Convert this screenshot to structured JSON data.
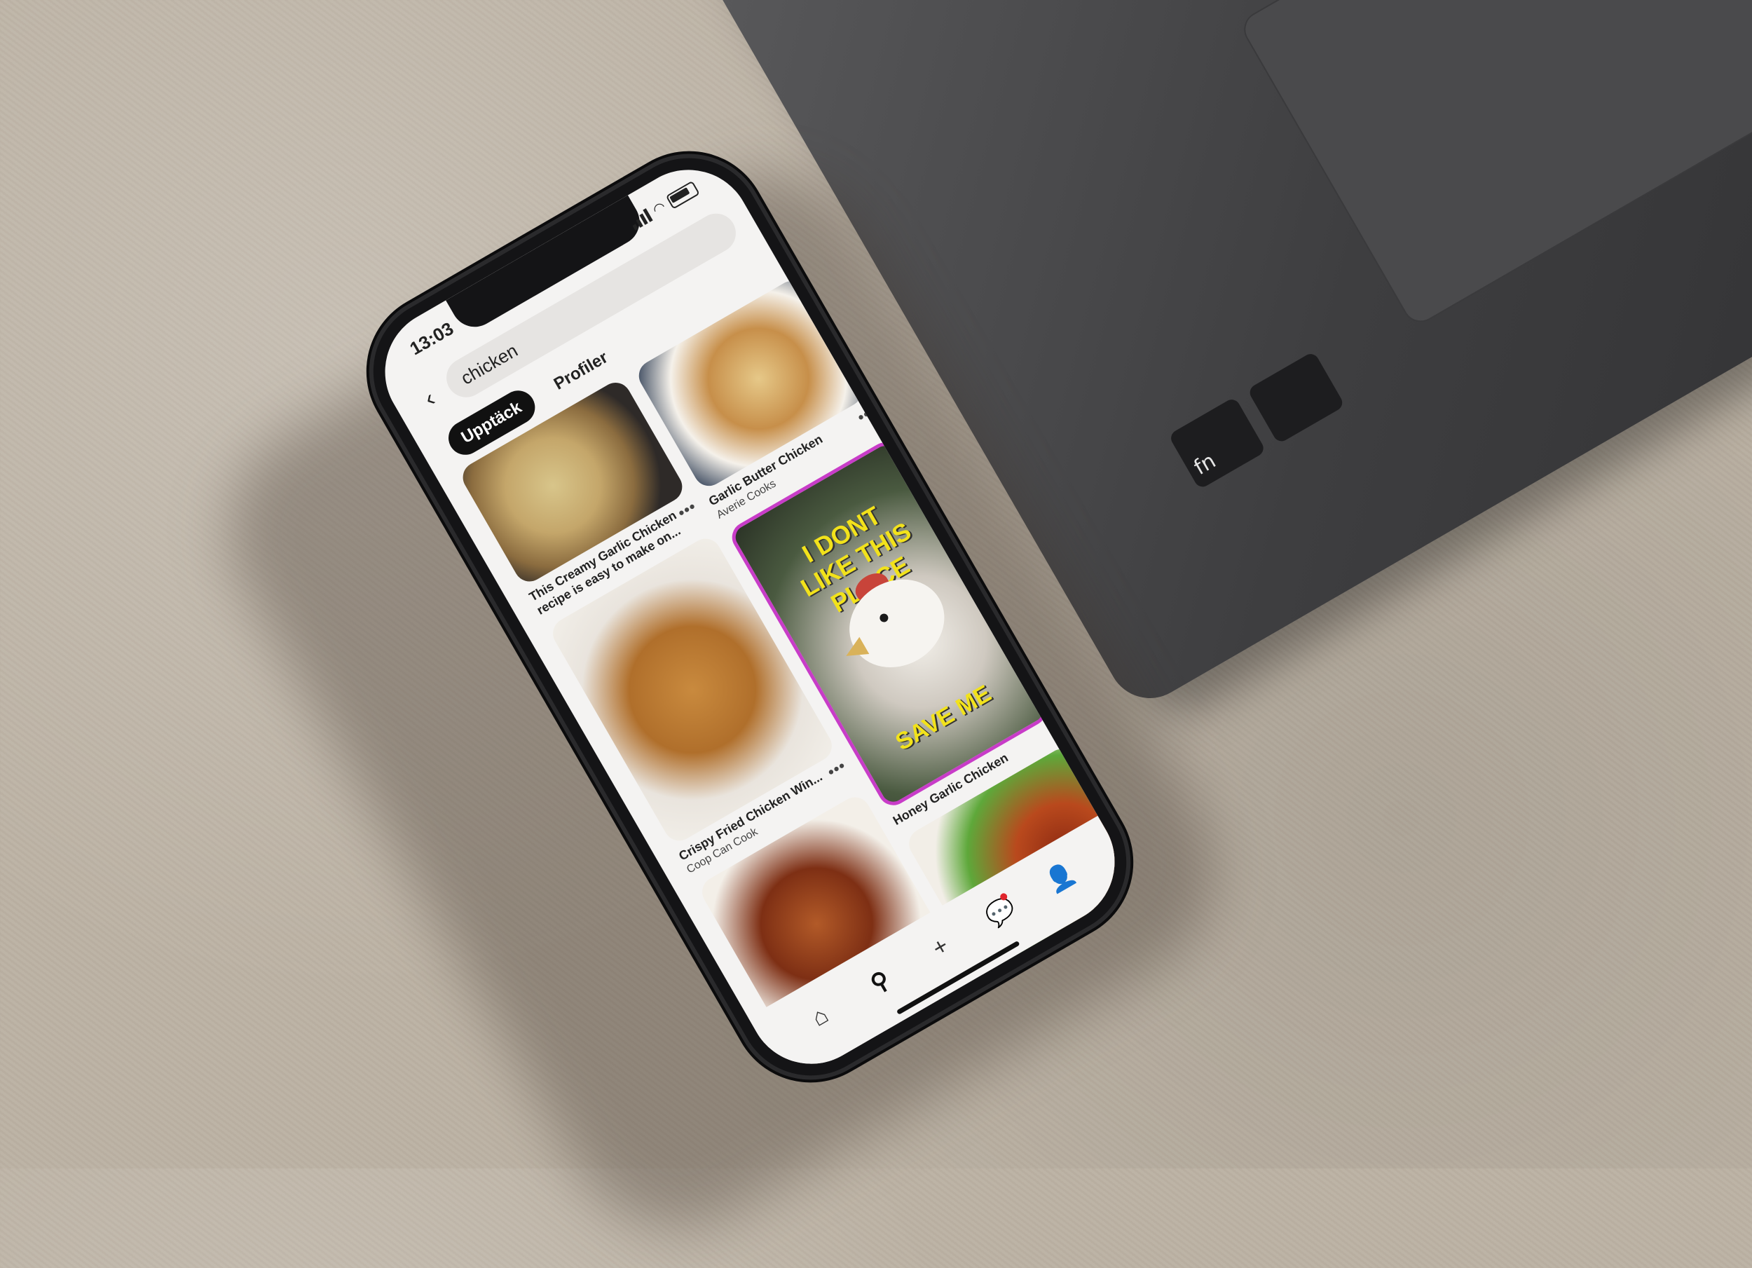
{
  "laptop": {
    "key_label": "fn"
  },
  "status": {
    "time": "13:03"
  },
  "search": {
    "query": "chicken"
  },
  "tabs": [
    {
      "label": "Upptäck",
      "active": true
    },
    {
      "label": "Profiler",
      "active": false
    }
  ],
  "pins": {
    "creamy": {
      "title": "This Creamy Garlic Chicken recipe is easy to make on..."
    },
    "fried": {
      "title": "Crispy Fried Chicken Win...",
      "source": "Coop Can Cook"
    },
    "butter": {
      "title": "Garlic Butter Chicken",
      "source": "Averie Cooks"
    },
    "meme": {
      "top_text": "I DONT LIKE THIS PLACE",
      "bottom_text": "SAVE ME",
      "title": "Honey Garlic Chicken"
    }
  },
  "nav": {
    "home_icon": "home-icon",
    "search_icon": "search-icon",
    "create_icon": "plus-icon",
    "messages_icon": "chat-icon",
    "profile_icon": "profile-icon"
  },
  "colors": {
    "meme_border": "#c83cc8",
    "meme_text": "#f2e21b",
    "notification": "#e0242c"
  }
}
